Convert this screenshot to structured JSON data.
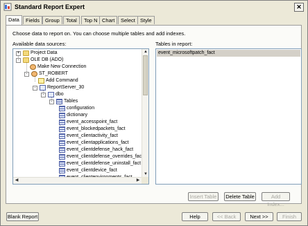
{
  "window": {
    "title": "Standard Report Expert"
  },
  "tabs": [
    {
      "label": "Data",
      "active": true
    },
    {
      "label": "Fields",
      "active": false
    },
    {
      "label": "Group",
      "active": false
    },
    {
      "label": "Total",
      "active": false
    },
    {
      "label": "Top N",
      "active": false
    },
    {
      "label": "Chart",
      "active": false
    },
    {
      "label": "Select",
      "active": false
    },
    {
      "label": "Style",
      "active": false
    }
  ],
  "instructions": "Choose data to report on. You can choose multiple tables and add indexes.",
  "available": {
    "label": "Available data sources:",
    "items": [
      {
        "label": "Project Data",
        "expander": "+",
        "icon": "folder-icon"
      },
      {
        "label": "OLE DB (ADO)",
        "expander": "-",
        "icon": "folder-icon"
      },
      {
        "label": "Make New Connection",
        "expander": "",
        "icon": "person-icon"
      },
      {
        "label": "ST_ROBERT",
        "expander": "-",
        "icon": "person-icon"
      },
      {
        "label": "Add Command",
        "expander": "",
        "icon": "command-icon"
      },
      {
        "label": "ReportServer_30",
        "expander": "-",
        "icon": "database-icon"
      },
      {
        "label": "dbo",
        "expander": "-",
        "icon": "database-icon"
      },
      {
        "label": "Tables",
        "expander": "-",
        "icon": "tables-icon"
      },
      {
        "label": "configuration",
        "expander": "",
        "icon": "table-icon"
      },
      {
        "label": "dictionary",
        "expander": "",
        "icon": "table-icon"
      },
      {
        "label": "event_accesspoint_fact",
        "expander": "",
        "icon": "table-icon"
      },
      {
        "label": "event_blockedpackets_fact",
        "expander": "",
        "icon": "table-icon"
      },
      {
        "label": "event_clientactivity_fact",
        "expander": "",
        "icon": "table-icon"
      },
      {
        "label": "event_clientapplications_fact",
        "expander": "",
        "icon": "table-icon"
      },
      {
        "label": "event_clientdefense_hack_fact",
        "expander": "",
        "icon": "table-icon"
      },
      {
        "label": "event_clientdefense_overrides_fact",
        "expander": "",
        "icon": "table-icon"
      },
      {
        "label": "event_clientdefense_uninstall_fact",
        "expander": "",
        "icon": "table-icon"
      },
      {
        "label": "event_clientdevice_fact",
        "expander": "",
        "icon": "table-icon"
      },
      {
        "label": "event_clientenvironments_fact",
        "expander": "",
        "icon": "table-icon"
      }
    ]
  },
  "report_tables": {
    "label": "Tables in report:",
    "items": [
      "event_microsoftpatch_fact"
    ]
  },
  "buttons": {
    "insert_table": "Insert Table",
    "delete_table": "Delete Table",
    "add_index": "Add Index...",
    "blank_report": "Blank Report",
    "help": "Help",
    "back": "<< Back",
    "next": "Next >>",
    "finish": "Finish"
  }
}
